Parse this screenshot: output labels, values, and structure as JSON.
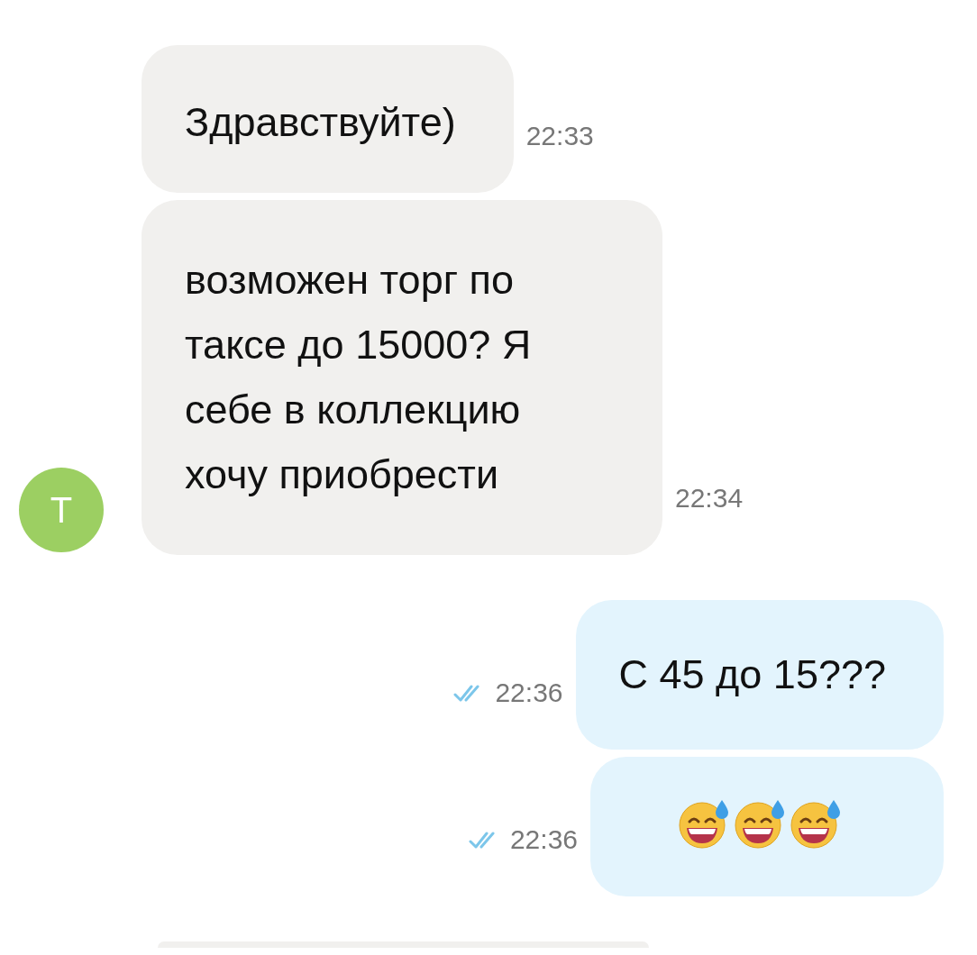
{
  "messages": [
    {
      "outgoing": false,
      "text": "Здравствуйте)",
      "time": "22:33"
    },
    {
      "outgoing": false,
      "text": "возможен торг по таксе до 15000? Я себе в коллекцию хочу приобрести",
      "time": "22:34",
      "avatar": "T"
    },
    {
      "outgoing": true,
      "text": "С 45 до 15???",
      "time": "22:36",
      "read": true
    },
    {
      "outgoing": true,
      "emoji": [
        {
          "kind": "sweat-smile"
        },
        {
          "kind": "sweat-smile"
        },
        {
          "kind": "sweat-smile"
        }
      ],
      "time": "22:36",
      "read": true
    },
    {
      "outgoing": false,
      "partial": true
    }
  ]
}
